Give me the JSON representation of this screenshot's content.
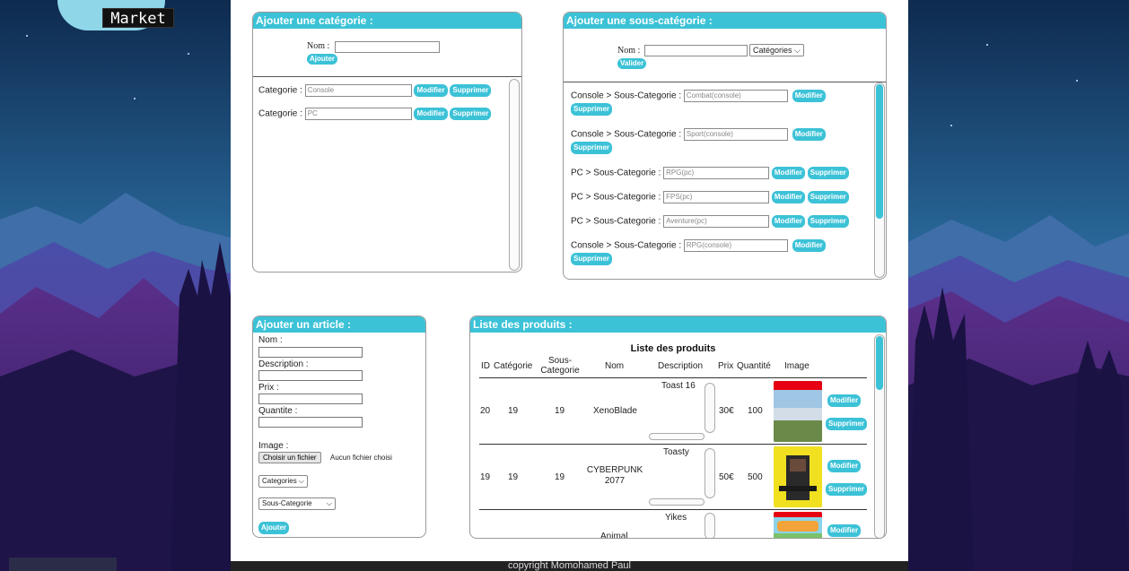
{
  "header": {
    "logo_text": "Market"
  },
  "colors": {
    "accent": "#3cc2d7",
    "page_bg": "#1b1640"
  },
  "category_panel": {
    "title": "Ajouter une catégorie :",
    "name_label": "Nom :",
    "add_button": "Ajouter",
    "row_label": "Categorie :",
    "edit_button": "Modifier",
    "delete_button": "Supprimer",
    "items": [
      {
        "value": "Console"
      },
      {
        "value": "PC"
      }
    ]
  },
  "subcategory_panel": {
    "title": "Ajouter une sous-catégorie :",
    "name_label": "Nom :",
    "category_select": "Catégories",
    "submit_button": "Valider",
    "edit_button": "Modifier",
    "delete_button": "Supprimer",
    "items": [
      {
        "label": "Console > Sous-Categorie :",
        "value": "Combat(console)"
      },
      {
        "label": "Console > Sous-Categorie :",
        "value": "Sport(console)"
      },
      {
        "label": "PC > Sous-Categorie :",
        "value": "RPG(pc)"
      },
      {
        "label": "PC > Sous-Categorie :",
        "value": "FPS(pc)"
      },
      {
        "label": "PC > Sous-Categorie :",
        "value": "Aventure(pc)"
      },
      {
        "label": "Console > Sous-Categorie :",
        "value": "RPG(console)"
      }
    ]
  },
  "article_panel": {
    "title": "Ajouter un article :",
    "name_label": "Nom :",
    "description_label": "Description :",
    "price_label": "Prix :",
    "quantity_label": "Quantite :",
    "image_label": "Image :",
    "file_button": "Choisir un fichier",
    "file_status": "Aucun fichier choisi",
    "category_select": "Categories",
    "subcategory_select": "Sous-Categorie",
    "submit_button": "Ajouter"
  },
  "products_panel": {
    "title": "Liste des produits :",
    "table_title": "Liste des produits",
    "headers": {
      "id": "ID",
      "category": "Catégorie",
      "subcategory_line1": "Sous-",
      "subcategory_line2": "Categorie",
      "name": "Nom",
      "description": "Description",
      "price": "Prix",
      "quantity": "Quantité",
      "image": "Image"
    },
    "edit_button": "Modifier",
    "delete_button": "Supprimer",
    "rows": [
      {
        "id": "20",
        "category": "19",
        "subcategory": "19",
        "name": "XenoBlade",
        "description": "Toast 16",
        "price": "30€",
        "quantity": "100"
      },
      {
        "id": "19",
        "category": "19",
        "subcategory": "19",
        "name_line1": "CYBERPUNK",
        "name_line2": "2077",
        "description": "Toasty",
        "price": "50€",
        "quantity": "500"
      },
      {
        "description": "Yikes",
        "name": "Animal"
      }
    ]
  },
  "footer": {
    "text": "copyright Momohamed Paul"
  }
}
